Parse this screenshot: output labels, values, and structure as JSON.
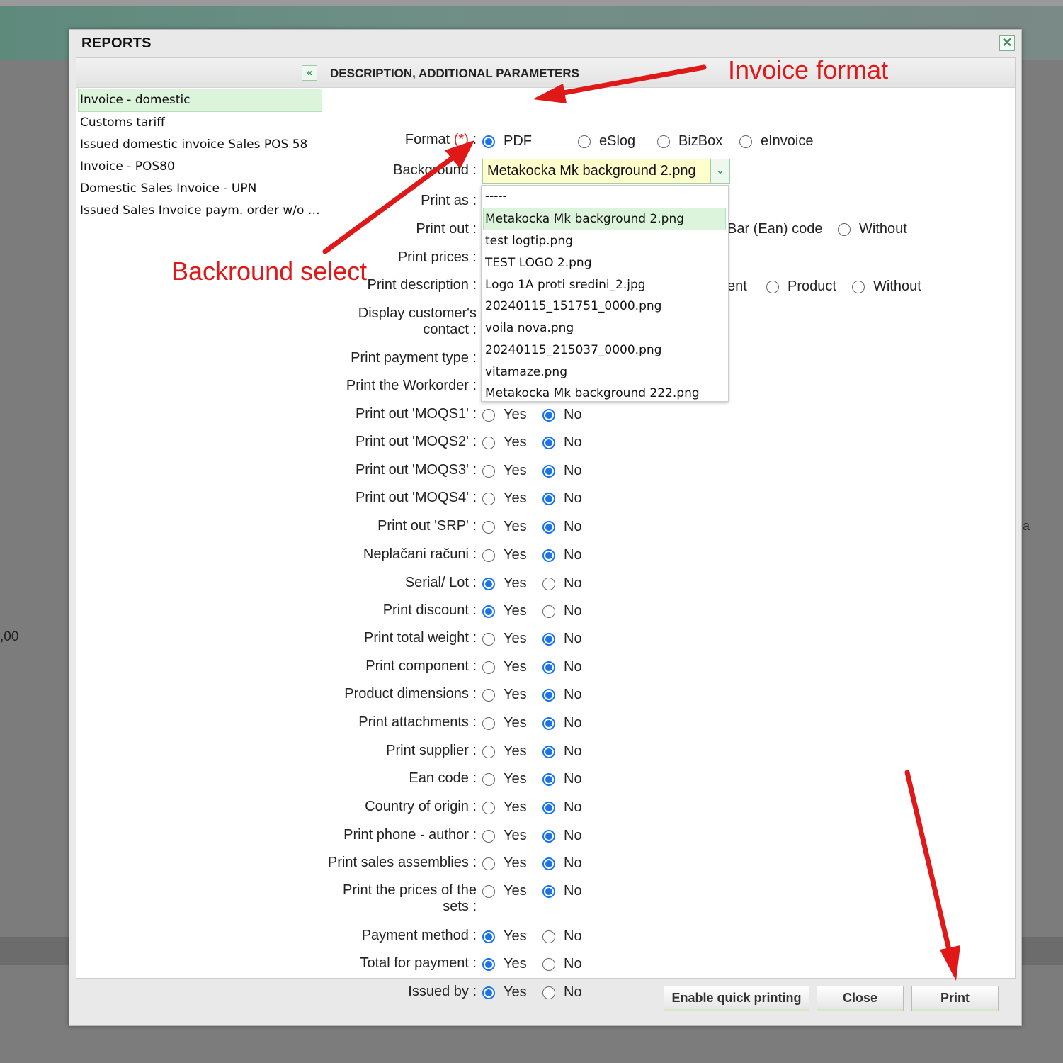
{
  "background": {
    "amount_fragment": ",00",
    "right_fragment": "a"
  },
  "dialog": {
    "title": "REPORTS",
    "close_glyph": "✕",
    "collapse_glyph": "«",
    "reports": [
      "Invoice - domestic",
      "Customs tariff",
      "Issued domestic invoice Sales POS 58",
      "Invoice - POS80",
      "Domestic Sales Invoice - UPN",
      "Issued Sales Invoice paym. order w/o b..."
    ],
    "panel_title": "DESCRIPTION, ADDITIONAL PARAMETERS",
    "format": {
      "label": "Format",
      "required": "(*)",
      "options": [
        "PDF",
        "eSlog",
        "BizBox",
        "eInvoice"
      ],
      "selected": "PDF"
    },
    "background_select": {
      "label": "Background :",
      "value": "Metakocka Mk background 2.png",
      "options": [
        "-----",
        "Metakocka Mk background 2.png",
        "test logtip.png",
        "TEST LOGO 2.png",
        "Logo 1A proti sredini_2.jpg",
        "20240115_151751_0000.png",
        "voila nova.png",
        "20240115_215037_0000.png",
        "vitamaze.png",
        "Metakocka Mk background 222.png"
      ]
    },
    "hidden_rows": {
      "print_as": "Print as :",
      "print_out": "Print out :",
      "print_out_opt1": "Bar (Ean) code",
      "print_out_opt2": "Without",
      "print_prices": "Print prices :",
      "print_description": "Print description :",
      "desc_opt0": "ent",
      "desc_opt1": "Product",
      "desc_opt2": "Without",
      "customer_contact": "Display customer's contact :",
      "payment_type": "Print payment type :",
      "workorder": "Print the Workorder :"
    },
    "yes_label": "Yes",
    "no_label": "No",
    "yes_no_rows": [
      {
        "label": "Print out 'MOQS1' :",
        "value": "No"
      },
      {
        "label": "Print out 'MOQS2' :",
        "value": "No"
      },
      {
        "label": "Print out 'MOQS3' :",
        "value": "No"
      },
      {
        "label": "Print out 'MOQS4' :",
        "value": "No"
      },
      {
        "label": "Print out 'SRP' :",
        "value": "No"
      },
      {
        "label": "Neplačani računi :",
        "value": "No"
      },
      {
        "label": "Serial/ Lot :",
        "value": "Yes"
      },
      {
        "label": "Print discount :",
        "value": "Yes"
      },
      {
        "label": "Print total weight :",
        "value": "No"
      },
      {
        "label": "Print component :",
        "value": "No"
      },
      {
        "label": "Product dimensions :",
        "value": "No"
      },
      {
        "label": "Print attachments :",
        "value": "No"
      },
      {
        "label": "Print supplier :",
        "value": "No"
      },
      {
        "label": "Ean code :",
        "value": "No"
      },
      {
        "label": "Country of origin :",
        "value": "No"
      },
      {
        "label": "Print phone - author :",
        "value": "No"
      },
      {
        "label": "Print sales assemblies :",
        "value": "No"
      },
      {
        "label": "Print the prices of the sets :",
        "value": "No"
      },
      {
        "label": "Payment method :",
        "value": "Yes"
      },
      {
        "label": "Total for payment :",
        "value": "Yes"
      },
      {
        "label": "Issued by :",
        "value": "Yes"
      }
    ],
    "buttons": {
      "quick": "Enable quick printing",
      "close": "Close",
      "print": "Print"
    }
  },
  "annotations": {
    "invoice_format": "Invoice format",
    "background_select": "Backround select",
    "color": "#e01818"
  }
}
